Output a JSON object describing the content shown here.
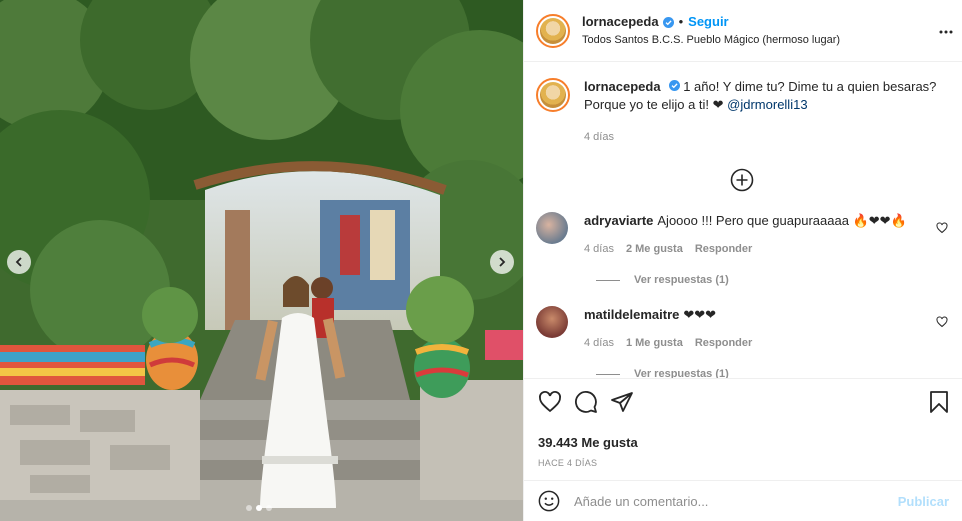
{
  "post": {
    "username": "lornacepeda",
    "follow_label": "Seguir",
    "separator": "•",
    "location": "Todos Santos B.C.S. Pueblo Mágico (hermoso lugar)",
    "caption": "1 año! Y dime tu? Dime tu a quien besaras? Porque yo te elijo a ti! ❤",
    "mention": "@jdrmorelli13",
    "caption_time": "4 días",
    "likes": "39.443 Me gusta",
    "posted_ago": "HACE 4 DÍAS",
    "carousel": {
      "slides": 3,
      "active_index": 1
    }
  },
  "comments": [
    {
      "username": "adryaviarte",
      "text": "Ajoooo !!! Pero que guapuraaaaa 🔥❤❤🔥",
      "time": "4 días",
      "likes": "2 Me gusta",
      "reply_label": "Responder",
      "view_replies": "Ver respuestas (1)"
    },
    {
      "username": "matildelemaitre",
      "text": "❤❤❤",
      "time": "4 días",
      "likes": "1 Me gusta",
      "reply_label": "Responder",
      "view_replies": "Ver respuestas (1)"
    }
  ],
  "composer": {
    "placeholder": "Añade un comentario...",
    "post_label": "Publicar"
  },
  "colors": {
    "accent": "#0095f6",
    "post_disabled": "#b2dffc",
    "text": "#262626",
    "muted": "#8e8e8e"
  }
}
